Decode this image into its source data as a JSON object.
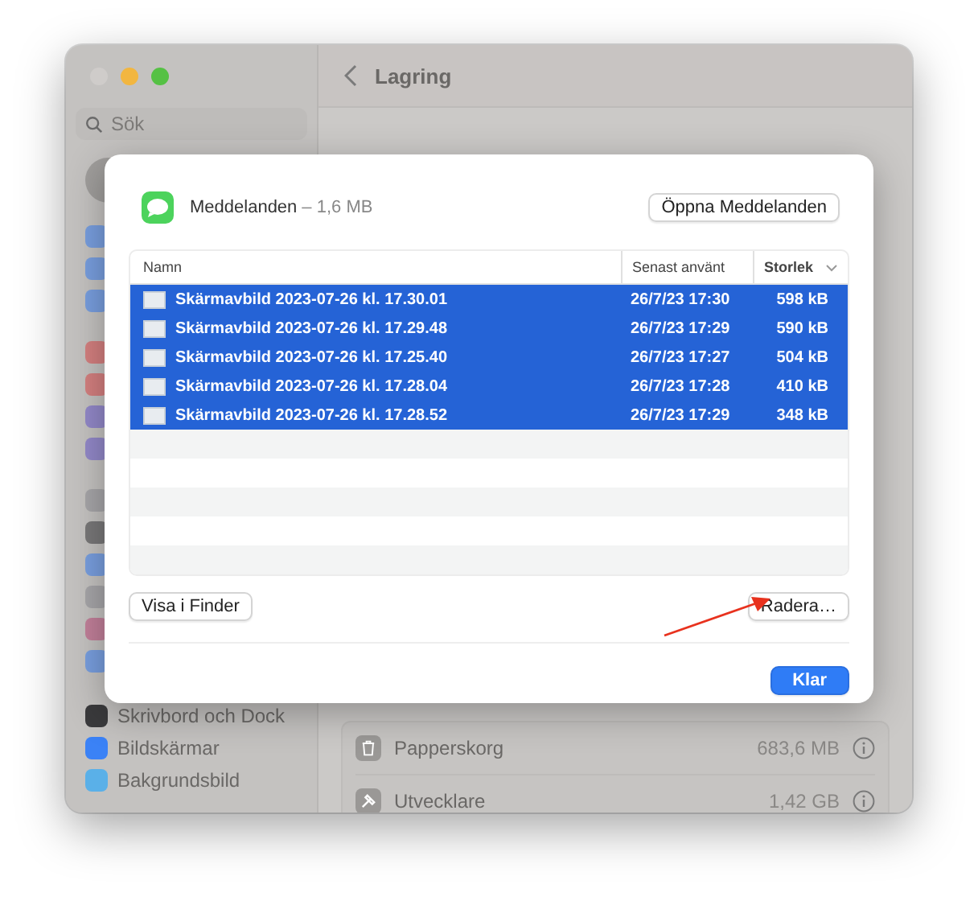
{
  "window": {
    "title": "Lagring"
  },
  "sidebar": {
    "search": {
      "placeholder": "Sök"
    },
    "items": [
      {
        "label": "Skrivbord och Dock",
        "color": "#3a3a3c"
      },
      {
        "label": "Bildskärmar",
        "color": "#3b82f6"
      },
      {
        "label": "Bakgrundsbild",
        "color": "#5ab0e8"
      }
    ]
  },
  "storage_rows": [
    {
      "label": "Papperskorg",
      "size": "683,6 MB",
      "kind": "trash"
    },
    {
      "label": "Utvecklare",
      "size": "1,42 GB",
      "kind": "hammer"
    }
  ],
  "dialog": {
    "app_name": "Meddelanden",
    "app_size": "– 1,6 MB",
    "open_button": "Öppna Meddelanden",
    "table": {
      "columns": [
        {
          "label": "Namn",
          "sorted": false
        },
        {
          "label": "Senast använt",
          "sorted": false
        },
        {
          "label": "Storlek",
          "sorted": true
        }
      ],
      "rows": [
        {
          "name": "Skärmavbild 2023-07-26 kl. 17.30.01",
          "date": "26/7/23 17:30",
          "size": "598 kB",
          "selected": true
        },
        {
          "name": "Skärmavbild 2023-07-26 kl. 17.29.48",
          "date": "26/7/23 17:29",
          "size": "590 kB",
          "selected": true
        },
        {
          "name": "Skärmavbild 2023-07-26 kl. 17.25.40",
          "date": "26/7/23 17:27",
          "size": "504 kB",
          "selected": true
        },
        {
          "name": "Skärmavbild 2023-07-26 kl. 17.28.04",
          "date": "26/7/23 17:28",
          "size": "410 kB",
          "selected": true
        },
        {
          "name": "Skärmavbild 2023-07-26 kl. 17.28.52",
          "date": "26/7/23 17:29",
          "size": "348 kB",
          "selected": true
        }
      ]
    },
    "show_button": "Visa i Finder",
    "delete_button": "Radera…",
    "done_button": "Klar"
  }
}
